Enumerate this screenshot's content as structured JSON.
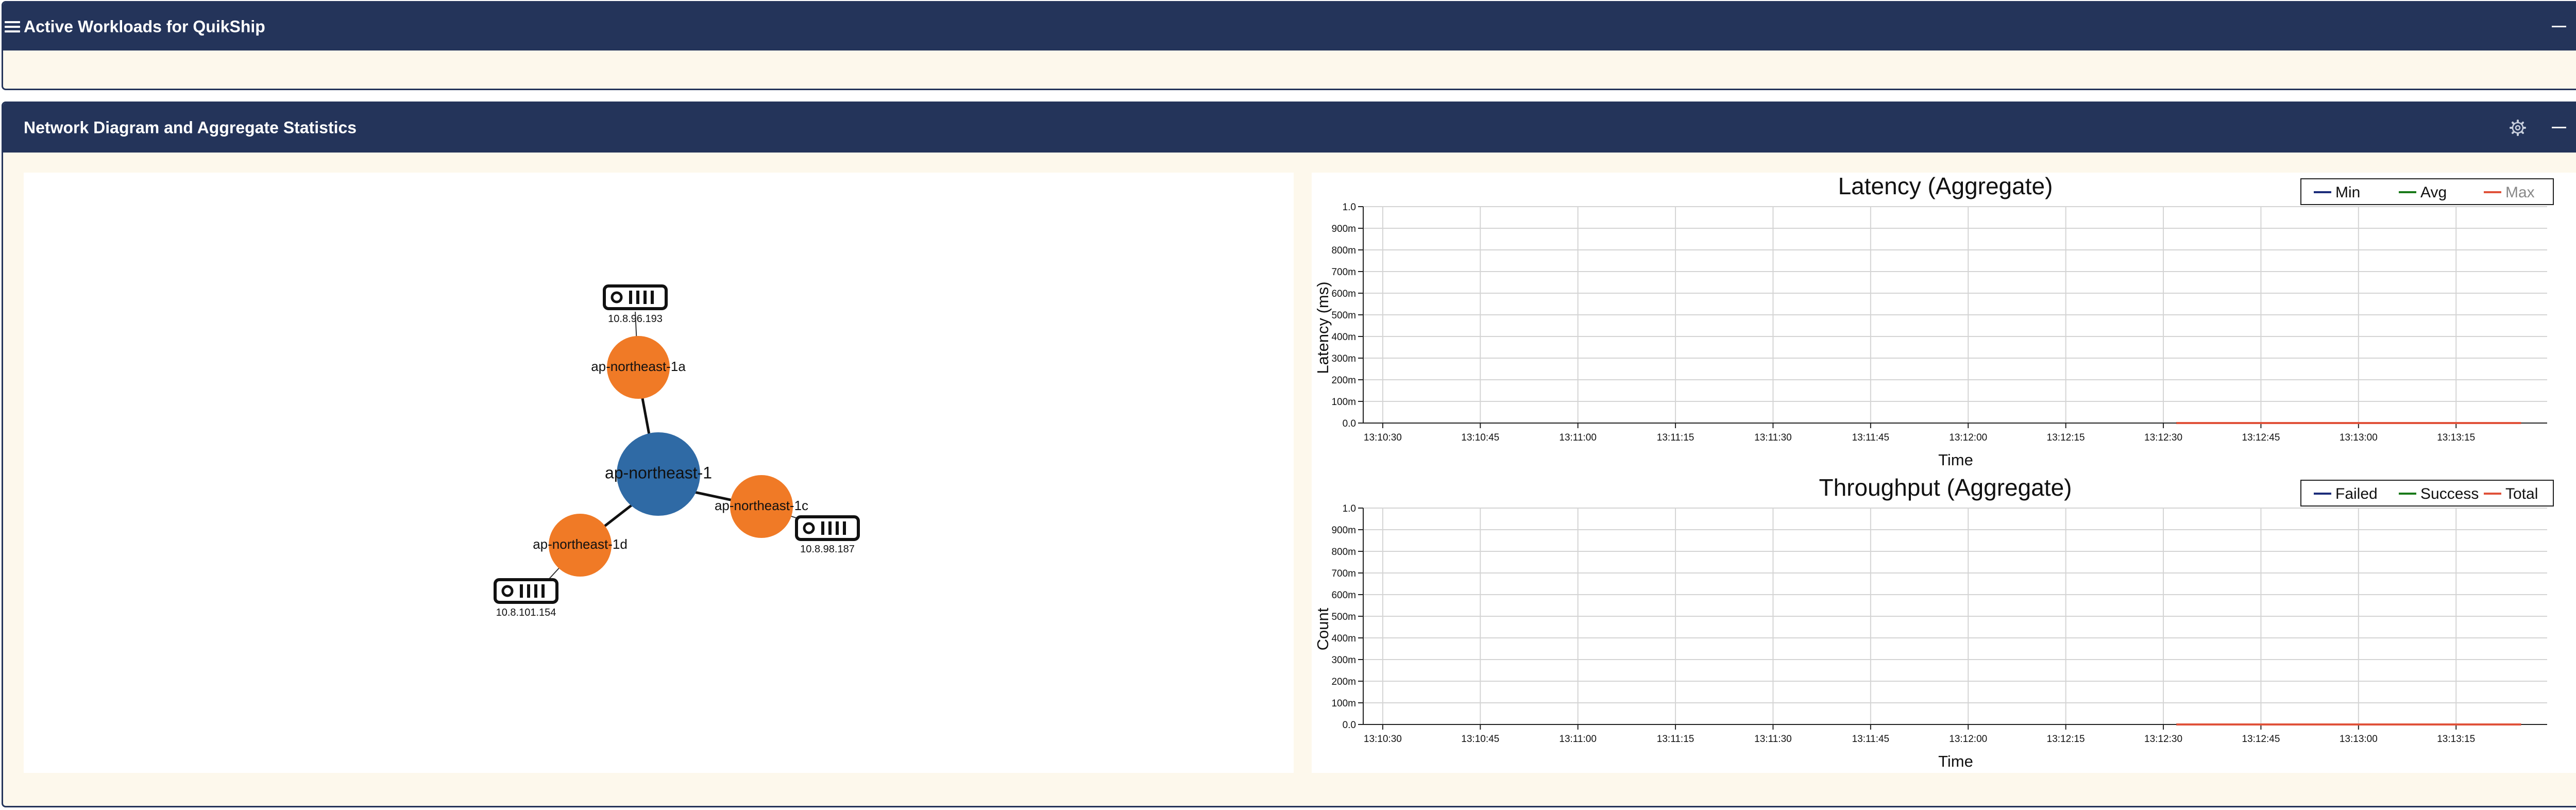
{
  "panels": {
    "workloads": {
      "title": "Active Workloads for QuikShip"
    },
    "network": {
      "title": "Network Diagram and Aggregate Statistics"
    }
  },
  "icons": {
    "menu": "hamburger-menu-icon",
    "minimize": "minimize-icon",
    "settings": "gear-icon",
    "server": "server-icon"
  },
  "colors": {
    "header_bg": "#24345a",
    "panel_bg": "#fdf8ec",
    "region_node": "#2f6aa5",
    "zone_node": "#f07a26",
    "series_min": "#1c2d7a",
    "series_avg": "#1a7a1a",
    "series_max": "#e0523a",
    "series_failed": "#1c2d7a",
    "series_success": "#1a7a1a",
    "series_total": "#e0523a"
  },
  "network": {
    "region": {
      "label": "ap-northeast-1"
    },
    "zones": [
      {
        "label": "ap-northeast-1a",
        "server_ip": "10.8.96.193"
      },
      {
        "label": "ap-northeast-1c",
        "server_ip": "10.8.98.187"
      },
      {
        "label": "ap-northeast-1d",
        "server_ip": "10.8.101.154"
      }
    ]
  },
  "chart_data": [
    {
      "type": "line",
      "title": "Latency (Aggregate)",
      "xlabel": "Time",
      "ylabel": "Latency (ms)",
      "x_ticks": [
        "13:10:30",
        "13:10:45",
        "13:11:00",
        "13:11:15",
        "13:11:30",
        "13:11:45",
        "13:12:00",
        "13:12:15",
        "13:12:30",
        "13:12:45",
        "13:13:00",
        "13:13:15"
      ],
      "y_ticks": [
        "0.0",
        "100m",
        "200m",
        "300m",
        "400m",
        "500m",
        "600m",
        "700m",
        "800m",
        "900m",
        "1.0"
      ],
      "ylim": [
        0,
        1
      ],
      "grid": true,
      "legend_position": "top-right",
      "series": [
        {
          "name": "Min",
          "color": "#1c2d7a",
          "x": [
            "13:12:32",
            "13:13:25"
          ],
          "values": [
            0,
            0
          ]
        },
        {
          "name": "Avg",
          "color": "#1a7a1a",
          "x": [
            "13:12:32",
            "13:13:25"
          ],
          "values": [
            0,
            0
          ]
        },
        {
          "name": "Max",
          "color": "#e0523a",
          "x": [
            "13:12:32",
            "13:13:25"
          ],
          "values": [
            0,
            0
          ]
        }
      ]
    },
    {
      "type": "line",
      "title": "Throughput (Aggregate)",
      "xlabel": "Time",
      "ylabel": "Count",
      "x_ticks": [
        "13:10:30",
        "13:10:45",
        "13:11:00",
        "13:11:15",
        "13:11:30",
        "13:11:45",
        "13:12:00",
        "13:12:15",
        "13:12:30",
        "13:12:45",
        "13:13:00",
        "13:13:15"
      ],
      "y_ticks": [
        "0.0",
        "100m",
        "200m",
        "300m",
        "400m",
        "500m",
        "600m",
        "700m",
        "800m",
        "900m",
        "1.0"
      ],
      "ylim": [
        0,
        1
      ],
      "grid": true,
      "legend_position": "top-right",
      "series": [
        {
          "name": "Failed",
          "color": "#1c2d7a",
          "x": [
            "13:12:32",
            "13:13:25"
          ],
          "values": [
            0,
            0
          ]
        },
        {
          "name": "Success",
          "color": "#1a7a1a",
          "x": [
            "13:12:32",
            "13:13:25"
          ],
          "values": [
            0,
            0
          ]
        },
        {
          "name": "Total",
          "color": "#e0523a",
          "x": [
            "13:12:32",
            "13:13:25"
          ],
          "values": [
            0,
            0
          ]
        }
      ]
    }
  ]
}
